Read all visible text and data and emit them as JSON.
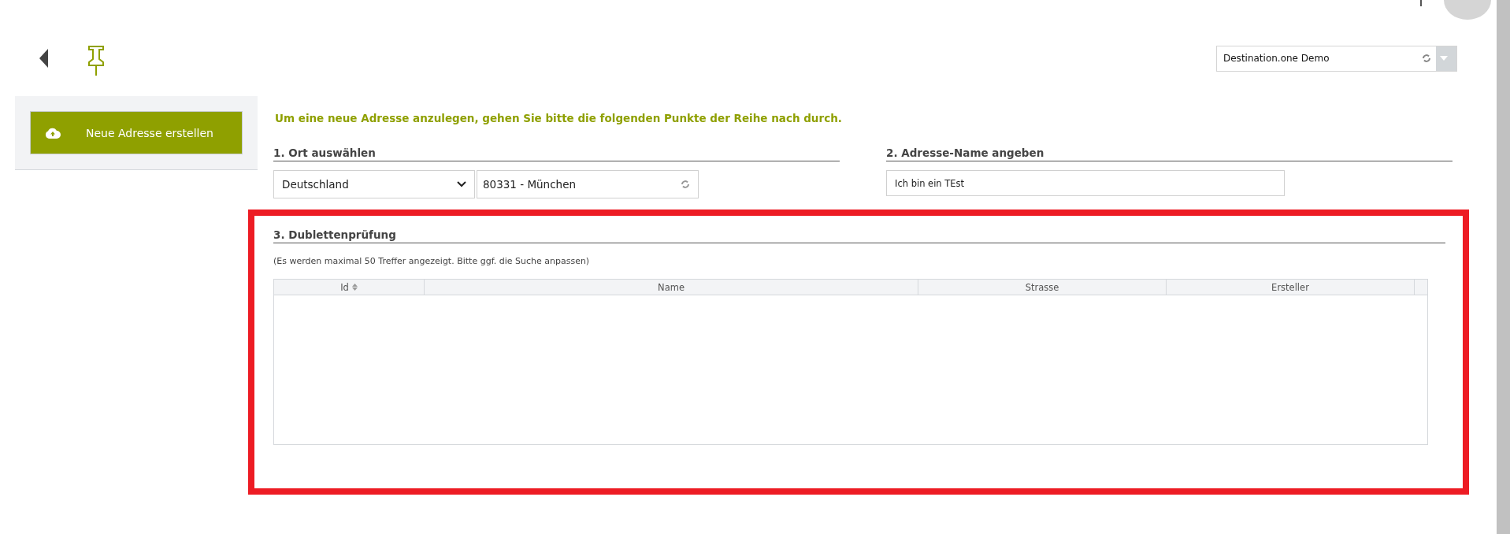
{
  "header": {
    "organisation_select": {
      "value": "Destination.one Demo"
    }
  },
  "sidebar": {
    "create_button": "Neue Adresse erstellen"
  },
  "intro": "Um eine neue Adresse anzulegen, gehen Sie bitte die folgenden Punkte der Reihe nach durch.",
  "step_1": {
    "heading": "1. Ort auswählen",
    "country": "Deutschland",
    "city": "80331 - München"
  },
  "step_2": {
    "heading": "2. Adresse-Name angeben",
    "name": "Ich bin ein TEst"
  },
  "step_3": {
    "highlighted": true,
    "heading": "3. Dublettenprüfung",
    "note": "(Es werden maximal 50 Treffer angezeigt. Bitte ggf. die Suche anpassen)",
    "table": {
      "columns": [
        {
          "label": "Id",
          "sortable": true
        },
        {
          "label": "Name",
          "sortable": false
        },
        {
          "label": "Strasse",
          "sortable": false
        },
        {
          "label": "Ersteller",
          "sortable": false
        }
      ]
    }
  }
}
